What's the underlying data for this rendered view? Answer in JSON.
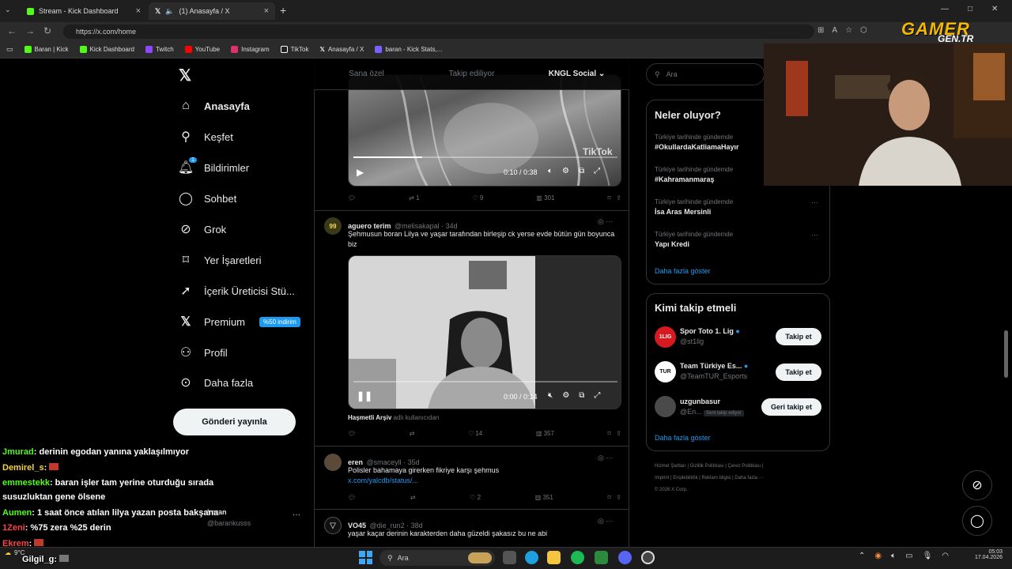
{
  "browser": {
    "tabs": [
      {
        "label": "Stream - Kick Dashboard",
        "icon": "kick-icon",
        "color": "#53fc18"
      },
      {
        "label": "(1) Anasayfa / X",
        "icon": "x-icon",
        "color": "#ffffff"
      }
    ],
    "url": "https://x.com/home",
    "bookmarks": [
      {
        "label": "Baran | Kick",
        "color": "#53fc18"
      },
      {
        "label": "Kick Dashboard",
        "color": "#53fc18"
      },
      {
        "label": "Twitch",
        "color": "#9146ff"
      },
      {
        "label": "YouTube",
        "color": "#ff0000"
      },
      {
        "label": "Instagram",
        "color": "#e1306c"
      },
      {
        "label": "TikTok",
        "color": "#ffffff"
      },
      {
        "label": "Anasayfa / X",
        "color": "#ffffff"
      },
      {
        "label": "baran - Kick Stats,...",
        "color": "#7b61ff"
      }
    ]
  },
  "nav": {
    "items": [
      {
        "label": "Anasayfa",
        "icon": "home-icon"
      },
      {
        "label": "Keşfet",
        "icon": "search-icon"
      },
      {
        "label": "Bildirimler",
        "icon": "bell-icon",
        "badge": "1"
      },
      {
        "label": "Sohbet",
        "icon": "chat-icon"
      },
      {
        "label": "Grok",
        "icon": "grok-icon"
      },
      {
        "label": "Yer İşaretleri",
        "icon": "bookmark-icon"
      },
      {
        "label": "İçerik Üreticisi Stü...",
        "icon": "rocket-icon"
      },
      {
        "label": "Premium",
        "icon": "x-icon",
        "badge": "%50 indirim"
      },
      {
        "label": "Profil",
        "icon": "person-icon"
      },
      {
        "label": "Daha fazla",
        "icon": "more-circle-icon"
      }
    ],
    "post_button": "Gönderi yayınla",
    "account": {
      "name": "baran",
      "handle": "@barankusss"
    }
  },
  "timeline": {
    "tabs": [
      "Sana özel",
      "Takip ediliyor",
      "KNGL Social"
    ],
    "video1": {
      "time": "0:10 / 0:38",
      "watermark": "TikTok",
      "progress": 0.26
    },
    "tweet0_actions": {
      "replies": "",
      "reposts": "1",
      "likes": "9",
      "views": "301"
    },
    "tweet1": {
      "name": "aguero terim",
      "handle": "@melisakapal · 34d",
      "avatar_text": "99",
      "text": "Şehmusun boran Lilya ve yaşar tarafından birleşip ck yerse evde bütün gün boyunca biz",
      "video_time": "0:00 / 0:14",
      "progress": 0.0,
      "source_name": "Haşmetli Arşiv",
      "source_suffix": "adlı kullanıcıdan",
      "actions": {
        "replies": "",
        "reposts": "",
        "likes": "14",
        "views": "357"
      }
    },
    "tweet2": {
      "name": "eren",
      "handle": "@smaceyll · 35d",
      "text": "Polisler bahamaya girerken fikriye karşı şehmus",
      "link": "x.com/yalcdb/status/...",
      "actions": {
        "replies": "",
        "reposts": "",
        "likes": "2",
        "views": "351"
      }
    },
    "tweet3": {
      "name": "VO45",
      "handle": "@die_run2 · 38d",
      "text": "yaşar kaçar derinin karakterden daha güzeldi şakasız bu ne abi"
    }
  },
  "right": {
    "search_placeholder": "Ara",
    "trends_title": "Neler oluyor?",
    "trends": [
      {
        "context": "Türkiye tarihinde gündemde",
        "name": "#OkullardaKatliamaHayır"
      },
      {
        "context": "Türkiye tarihinde gündemde",
        "name": "#Kahramanmaraş"
      },
      {
        "context": "Türkiye tarihinde gündemde",
        "name": "İsa Aras Mersinli"
      },
      {
        "context": "Türkiye tarihinde gündemde",
        "name": "Yapı Kredi"
      }
    ],
    "trends_more": "Daha fazla göster",
    "who_title": "Kimi takip etmeli",
    "who": [
      {
        "name": "Spor Toto 1. Lig",
        "handle": "@st1lig",
        "button": "Takip et",
        "avatar": "1LIG"
      },
      {
        "name": "Team Türkiye Es...",
        "handle": "@TeamTUR_Esports",
        "button": "Takip et",
        "avatar": "TUR"
      },
      {
        "name": "uzgunbasur",
        "handle": "@En...",
        "tag": "Seni takip ediyor",
        "button": "Geri takip et",
        "avatar": ""
      }
    ],
    "who_more": "Daha fazla göster",
    "footer": [
      "Hizmet Şartları",
      "Gizlilik Politikası",
      "Çerez Politikası",
      "Imprint",
      "Erişilebilirlik",
      "Reklam bilgisi",
      "Daha fazla ···",
      "© 2026 X Corp."
    ]
  },
  "chat": [
    {
      "user": "Jmurad",
      "msg": ": derinin egodan yanına yaklaşılmıyor",
      "color": "#53fc18"
    },
    {
      "user": "Demirel_s",
      "msg": ": ",
      "color": "#f5d142"
    },
    {
      "user": "emmestekk",
      "msg": ": baran işler tam yerine oturduğu sırada",
      "color": "#53fc18"
    },
    {
      "user": "",
      "msg": "susuzluktan gene ölsene",
      "color": "#ffffff"
    },
    {
      "user": "Aumen",
      "msg": ": 1 saat önce atılan lilya yazan posta bakşana",
      "color": "#53fc18"
    },
    {
      "user": "1Zeni",
      "msg": ": %75 zera %25 derin",
      "color": "#ff4444"
    },
    {
      "user": "Ekrem",
      "msg": ": ",
      "color": "#ff4444"
    },
    {
      "user": "Gilgil_g",
      "msg": ": ",
      "color": "#ffffff"
    }
  ],
  "overlay": {
    "brand": "GAMER",
    "brand_sub": "GEN.TR"
  },
  "taskbar": {
    "search": "Ara",
    "time": "05:03",
    "date": "17.04.2026",
    "weather": "9°C"
  }
}
